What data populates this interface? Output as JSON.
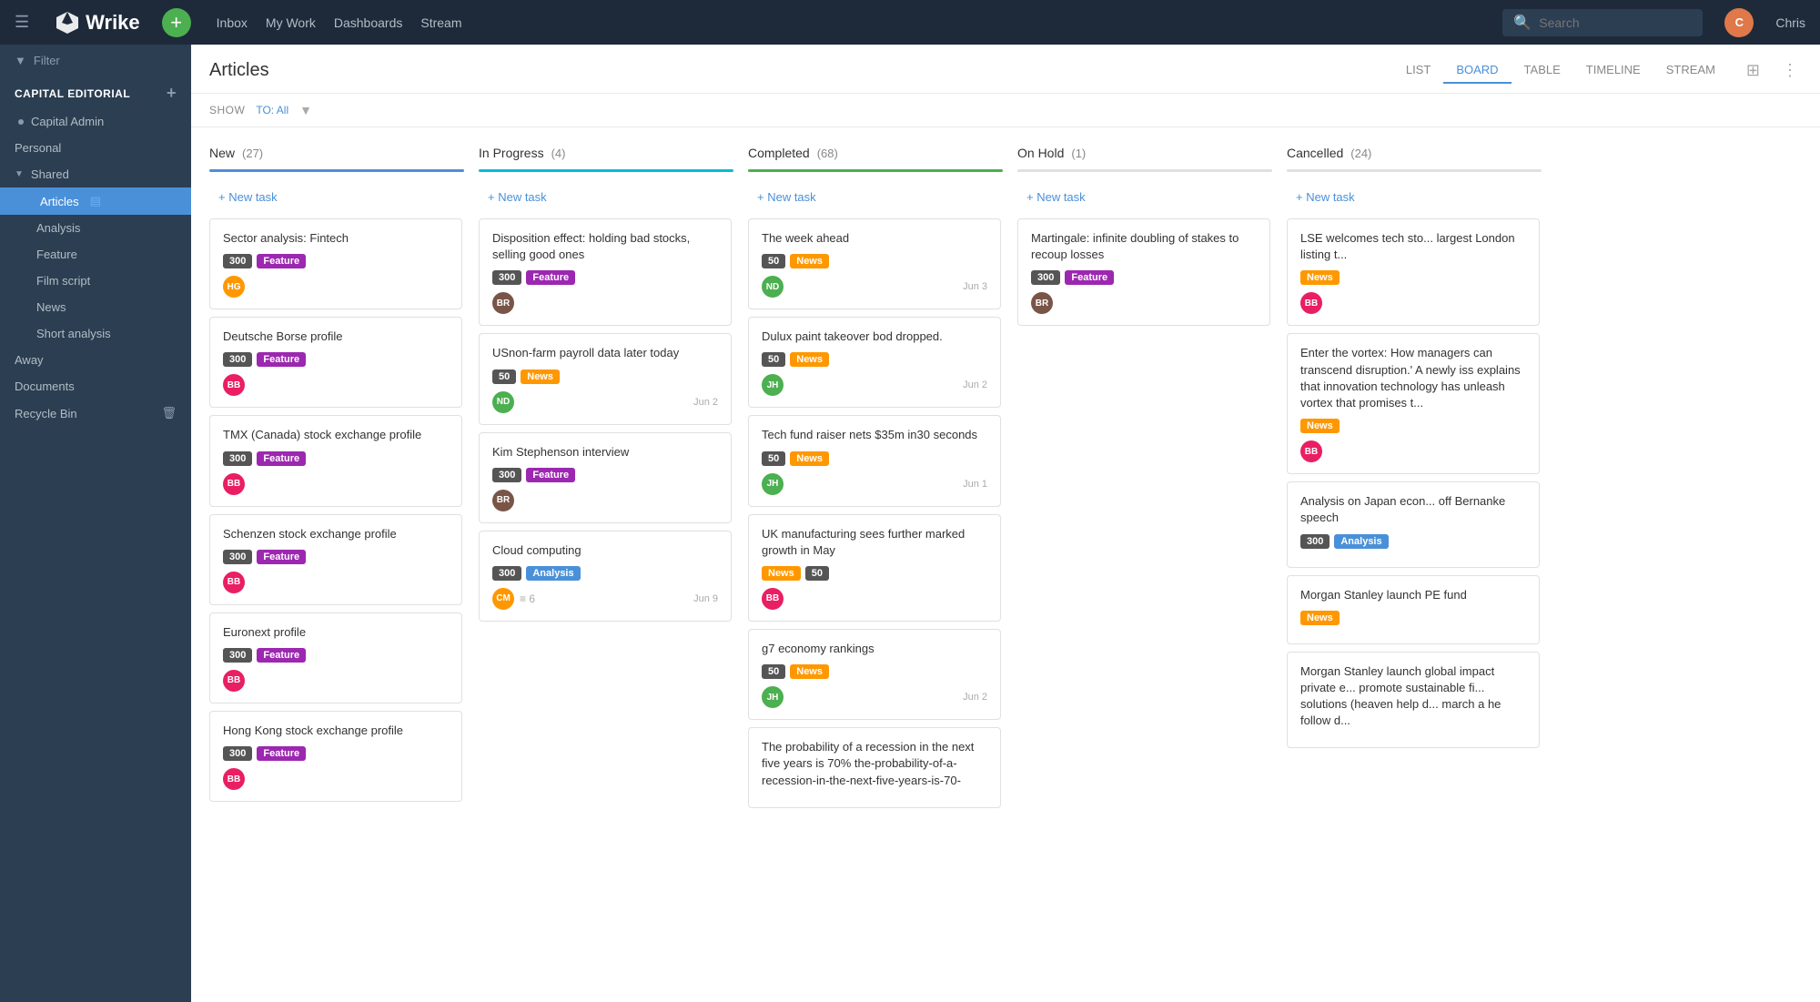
{
  "app": {
    "name": "Wrike"
  },
  "topnav": {
    "menu_icon": "☰",
    "add_btn": "+",
    "links": [
      "Inbox",
      "My Work",
      "Dashboards",
      "Stream"
    ],
    "search_placeholder": "Search",
    "username": "Chris"
  },
  "sidebar": {
    "filter_label": "Filter",
    "section": "CAPITAL EDITORIAL",
    "items": [
      {
        "label": "Capital Admin",
        "indent": 0,
        "has_dot": false
      },
      {
        "label": "Personal",
        "indent": 0,
        "has_dot": false
      },
      {
        "label": "Shared",
        "indent": 0,
        "expanded": true
      },
      {
        "label": "Articles",
        "indent": 1,
        "active": true,
        "has_doc": true
      },
      {
        "label": "Analysis",
        "indent": 2
      },
      {
        "label": "Feature",
        "indent": 2
      },
      {
        "label": "Film script",
        "indent": 2
      },
      {
        "label": "News",
        "indent": 2
      },
      {
        "label": "Short analysis",
        "indent": 2
      },
      {
        "label": "Away",
        "indent": 0
      },
      {
        "label": "Documents",
        "indent": 0
      },
      {
        "label": "Recycle Bin",
        "indent": 0
      }
    ]
  },
  "content": {
    "title": "Articles",
    "show_label": "SHOW",
    "filter_value": "TO: All",
    "view_tabs": [
      "LIST",
      "BOARD",
      "TABLE",
      "TIMELINE",
      "STREAM"
    ],
    "active_tab": "BOARD"
  },
  "columns": [
    {
      "id": "new",
      "title": "New",
      "count": 27,
      "color_class": "col-new",
      "cards": [
        {
          "title": "Sector analysis: Fintech",
          "tags": [
            {
              "label": "300",
              "cls": "tag-num"
            },
            {
              "label": "Feature",
              "cls": "tag-feature"
            }
          ],
          "avatar": "HG",
          "avatar_cls": "av-hg",
          "date": ""
        },
        {
          "title": "Deutsche Borse profile",
          "tags": [
            {
              "label": "300",
              "cls": "tag-num"
            },
            {
              "label": "Feature",
              "cls": "tag-feature"
            }
          ],
          "avatar": "BB",
          "avatar_cls": "av-bb",
          "date": ""
        },
        {
          "title": "TMX (Canada) stock exchange profile",
          "tags": [
            {
              "label": "300",
              "cls": "tag-num"
            },
            {
              "label": "Feature",
              "cls": "tag-feature"
            }
          ],
          "avatar": "BB",
          "avatar_cls": "av-bb",
          "date": ""
        },
        {
          "title": "Schenzen stock exchange profile",
          "tags": [
            {
              "label": "300",
              "cls": "tag-num"
            },
            {
              "label": "Feature",
              "cls": "tag-feature"
            }
          ],
          "avatar": "BB",
          "avatar_cls": "av-bb",
          "date": ""
        },
        {
          "title": "Euronext profile",
          "tags": [
            {
              "label": "300",
              "cls": "tag-num"
            },
            {
              "label": "Feature",
              "cls": "tag-feature"
            }
          ],
          "avatar": "BB",
          "avatar_cls": "av-bb",
          "date": ""
        },
        {
          "title": "Hong Kong stock exchange profile",
          "tags": [
            {
              "label": "300",
              "cls": "tag-num"
            },
            {
              "label": "Feature",
              "cls": "tag-feature"
            }
          ],
          "avatar": "BB",
          "avatar_cls": "av-bb",
          "date": ""
        }
      ]
    },
    {
      "id": "inprogress",
      "title": "In Progress",
      "count": 4,
      "color_class": "col-inprogress",
      "cards": [
        {
          "title": "Disposition effect: holding bad stocks, selling good ones",
          "tags": [
            {
              "label": "300",
              "cls": "tag-num"
            },
            {
              "label": "Feature",
              "cls": "tag-feature"
            }
          ],
          "avatar": "BR",
          "avatar_cls": "av-brown",
          "date": ""
        },
        {
          "title": "USnon-farm payroll data later today",
          "tags": [
            {
              "label": "50",
              "cls": "tag-num"
            },
            {
              "label": "News",
              "cls": "tag-news"
            }
          ],
          "avatar": "ND",
          "avatar_cls": "av-nd",
          "date": "Jun 2"
        },
        {
          "title": "Kim Stephenson interview",
          "tags": [
            {
              "label": "300",
              "cls": "tag-num"
            },
            {
              "label": "Feature",
              "cls": "tag-feature"
            }
          ],
          "avatar": "BR",
          "avatar_cls": "av-brown",
          "date": ""
        },
        {
          "title": "Cloud computing",
          "tags": [
            {
              "label": "300",
              "cls": "tag-num"
            },
            {
              "label": "Analysis",
              "cls": "tag-analysis"
            }
          ],
          "avatar": "CM",
          "avatar_cls": "av-cm",
          "date": "Jun 9",
          "subtask_count": "6"
        }
      ]
    },
    {
      "id": "completed",
      "title": "Completed",
      "count": 68,
      "color_class": "col-completed",
      "cards": [
        {
          "title": "The week ahead",
          "tags": [
            {
              "label": "50",
              "cls": "tag-num"
            },
            {
              "label": "News",
              "cls": "tag-news"
            }
          ],
          "avatar": "ND",
          "avatar_cls": "av-nd",
          "date": "Jun 3"
        },
        {
          "title": "Dulux paint takeover bod dropped.",
          "tags": [
            {
              "label": "50",
              "cls": "tag-num"
            },
            {
              "label": "News",
              "cls": "tag-news"
            }
          ],
          "avatar": "JH",
          "avatar_cls": "av-jh",
          "date": "Jun 2"
        },
        {
          "title": "Tech fund raiser nets $35m in30 seconds",
          "tags": [
            {
              "label": "50",
              "cls": "tag-num"
            },
            {
              "label": "News",
              "cls": "tag-news"
            }
          ],
          "avatar": "JH",
          "avatar_cls": "av-jh",
          "date": "Jun 1"
        },
        {
          "title": "UK manufacturing sees further marked growth in May",
          "tags": [
            {
              "label": "News",
              "cls": "tag-news"
            },
            {
              "label": "50",
              "cls": "tag-num"
            }
          ],
          "avatar": "BB",
          "avatar_cls": "av-bb",
          "date": ""
        },
        {
          "title": "g7 economy rankings",
          "tags": [
            {
              "label": "50",
              "cls": "tag-num"
            },
            {
              "label": "News",
              "cls": "tag-news"
            }
          ],
          "avatar": "JH",
          "avatar_cls": "av-jh",
          "date": "Jun 2"
        },
        {
          "title": "The probability of a recession in the next five years is 70% the-probability-of-a-recession-in-the-next-five-years-is-70-",
          "tags": [],
          "avatar": "",
          "avatar_cls": "",
          "date": ""
        }
      ]
    },
    {
      "id": "onhold",
      "title": "On Hold",
      "count": 1,
      "color_class": "col-onhold",
      "cards": [
        {
          "title": "Martingale: infinite doubling of stakes to recoup losses",
          "tags": [
            {
              "label": "300",
              "cls": "tag-num"
            },
            {
              "label": "Feature",
              "cls": "tag-feature"
            }
          ],
          "avatar": "BR",
          "avatar_cls": "av-brown",
          "date": ""
        }
      ]
    },
    {
      "id": "cancelled",
      "title": "Cancelled",
      "count": 24,
      "color_class": "col-cancelled",
      "cards": [
        {
          "title": "LSE welcomes tech sto... largest London listing t...",
          "tags": [
            {
              "label": "News",
              "cls": "tag-news"
            }
          ],
          "avatar": "BB",
          "avatar_cls": "av-bb",
          "date": ""
        },
        {
          "title": "Enter the vortex: How managers can transcend disruption.' A newly iss explains that innovation technology has unleash vortex that promises t...",
          "tags": [
            {
              "label": "News",
              "cls": "tag-news"
            }
          ],
          "avatar": "BB",
          "avatar_cls": "av-bb",
          "date": ""
        },
        {
          "title": "Analysis on Japan econ... off Bernanke speech",
          "tags": [
            {
              "label": "300",
              "cls": "tag-num"
            },
            {
              "label": "Analysis",
              "cls": "tag-analysis"
            }
          ],
          "avatar": "",
          "avatar_cls": "",
          "date": ""
        },
        {
          "title": "Morgan Stanley launch PE fund",
          "tags": [
            {
              "label": "News",
              "cls": "tag-news"
            }
          ],
          "avatar": "",
          "avatar_cls": "",
          "date": ""
        },
        {
          "title": "Morgan Stanley launch global impact private e... promote sustainable fi... solutions (heaven help d... march a he follow d...",
          "tags": [],
          "avatar": "",
          "avatar_cls": "",
          "date": ""
        }
      ]
    }
  ],
  "labels": {
    "new_task": "+ New task",
    "show": "SHOW",
    "to_all": "TO: All"
  }
}
